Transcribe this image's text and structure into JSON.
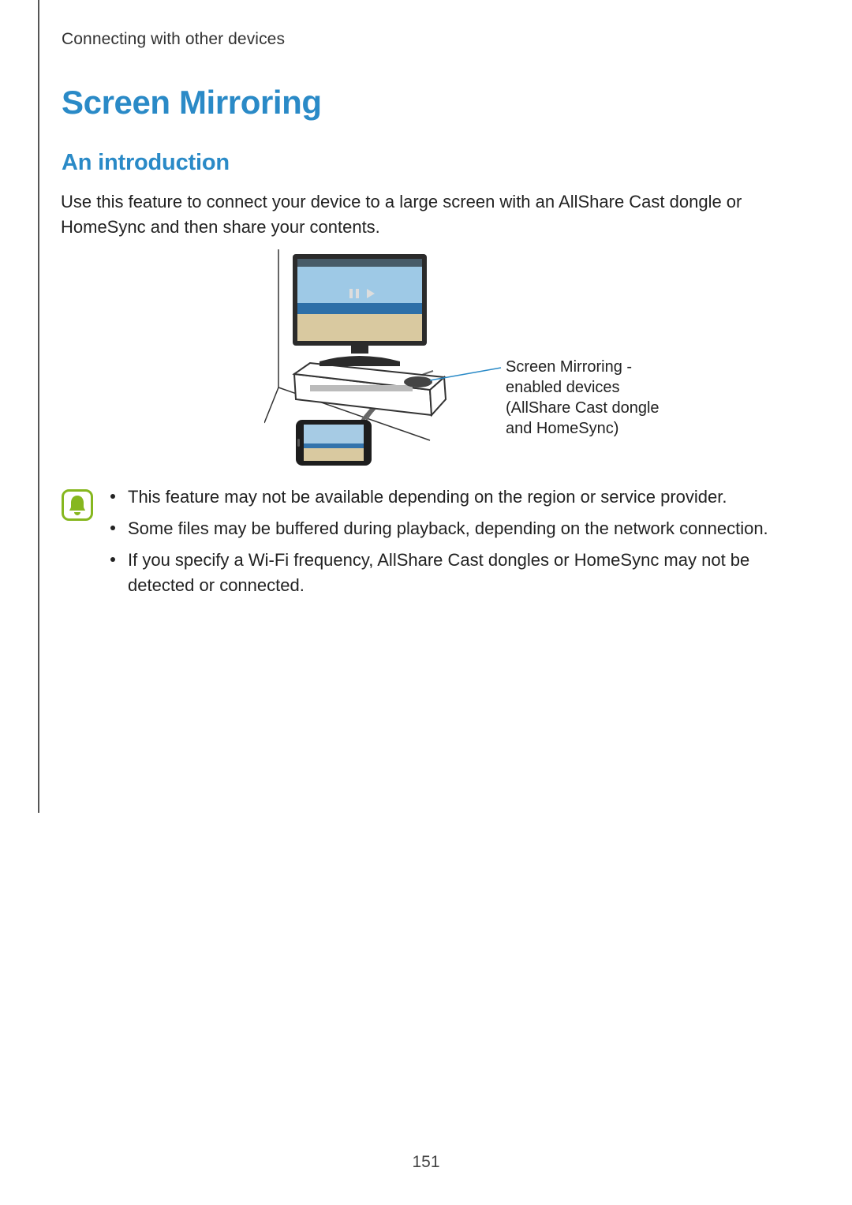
{
  "breadcrumb": "Connecting with other devices",
  "heading": "Screen Mirroring",
  "subheading": "An introduction",
  "intro_paragraph": "Use this feature to connect your device to a large screen with an AllShare Cast dongle or HomeSync and then share your contents.",
  "figure": {
    "callout": "Screen Mirroring -enabled devices (AllShare Cast dongle and HomeSync)"
  },
  "notes": {
    "items": [
      "This feature may not be available depending on the region or service provider.",
      "Some files may be buffered during playback, depending on the network connection.",
      "If you specify a Wi-Fi frequency, AllShare Cast dongles or HomeSync may not be detected or connected."
    ]
  },
  "page_number": "151"
}
